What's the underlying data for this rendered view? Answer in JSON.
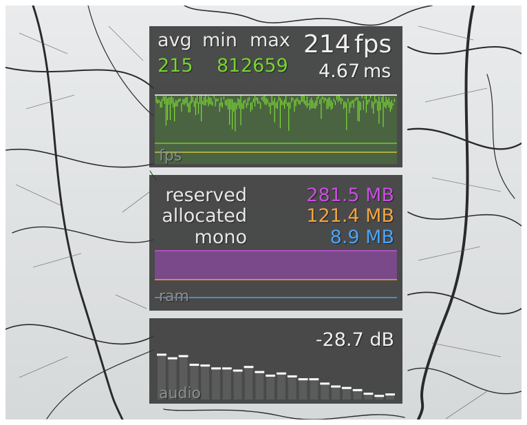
{
  "fps_panel": {
    "avg_label": "avg",
    "min_label": "min",
    "max_label": "max",
    "avg_value": "215",
    "min_value": "81",
    "max_value": "2659",
    "fps_value": "214",
    "fps_unit": "fps",
    "ms_value": "4.67",
    "ms_unit": "ms",
    "graph_label": "fps",
    "colors": {
      "stats": "#78d630",
      "graph": "#7ddc35",
      "avg_line": "#ffffff",
      "low_line": "#7ddc35",
      "min_line": "#e8d840"
    }
  },
  "ram_panel": {
    "reserved_label": "reserved",
    "allocated_label": "allocated",
    "mono_label": "mono",
    "reserved_value": "281.5 MB",
    "allocated_value": "121.4 MB",
    "mono_value": "8.9 MB",
    "graph_label": "ram",
    "colors": {
      "reserved": "#c94fe0",
      "allocated": "#f2a640",
      "mono": "#4ea3f5"
    }
  },
  "audio_panel": {
    "db_value": "-28.7 dB",
    "graph_label": "audio",
    "spectrum_levels": [
      0.62,
      0.57,
      0.6,
      0.48,
      0.47,
      0.43,
      0.43,
      0.4,
      0.45,
      0.38,
      0.33,
      0.36,
      0.32,
      0.28,
      0.28,
      0.22,
      0.18,
      0.16,
      0.13,
      0.08,
      0.05,
      0.07
    ]
  },
  "icons": {
    "background": "snowy-trees-image"
  }
}
